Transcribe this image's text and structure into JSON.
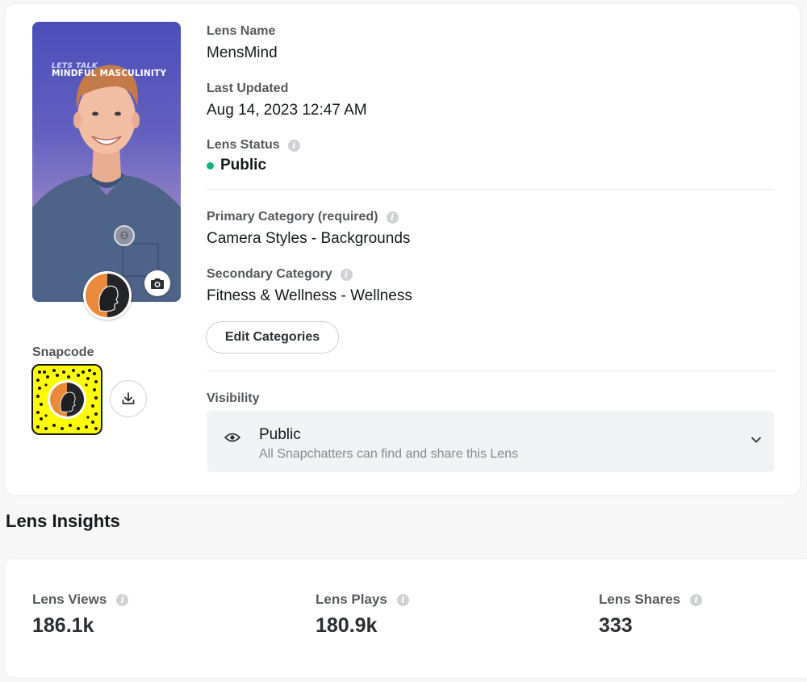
{
  "preview": {
    "overlay_line1": "LETS TALK",
    "overlay_line2": "MINDFUL MASCULINITY"
  },
  "snapcode": {
    "label": "Snapcode"
  },
  "details": {
    "lens_name_label": "Lens Name",
    "lens_name": "MensMind",
    "last_updated_label": "Last Updated",
    "last_updated": "Aug 14, 2023 12:47 AM",
    "lens_status_label": "Lens Status",
    "lens_status": "Public",
    "primary_category_label": "Primary Category (required)",
    "primary_category": "Camera Styles - Backgrounds",
    "secondary_category_label": "Secondary Category",
    "secondary_category": "Fitness & Wellness - Wellness",
    "edit_categories_label": "Edit Categories"
  },
  "visibility": {
    "label": "Visibility",
    "selected_title": "Public",
    "selected_description": "All Snapchatters can find and share this Lens"
  },
  "insights": {
    "title": "Lens Insights",
    "metrics": [
      {
        "label": "Lens Views",
        "value": "186.1k"
      },
      {
        "label": "Lens Plays",
        "value": "180.9k"
      },
      {
        "label": "Lens Shares",
        "value": "333"
      }
    ]
  },
  "colors": {
    "status_dot": "#10b47c",
    "snapcode_yellow": "#fffc00",
    "preview_gradient_top": "#4a4fb8",
    "preview_gradient_bottom": "#b7a1d2"
  }
}
